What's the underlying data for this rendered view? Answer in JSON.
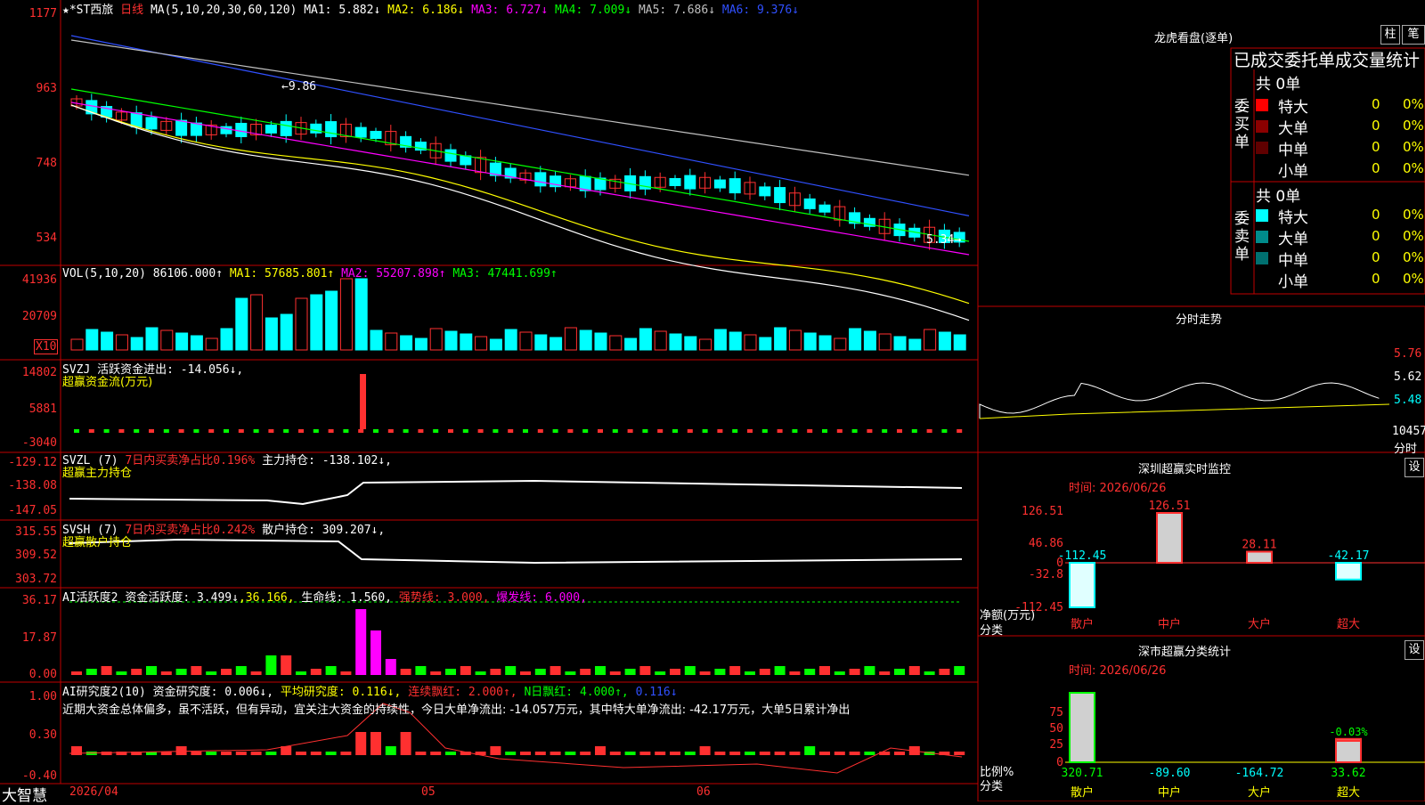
{
  "header": {
    "stock_name": "★*ST西旅",
    "period": "日线",
    "ma_label": "MA(5,10,20,30,60,120)",
    "ma_values": [
      {
        "name": "MA1:",
        "value": "5.882↓",
        "color": "#ffffff"
      },
      {
        "name": "MA2:",
        "value": "6.186↓",
        "color": "#ffff00"
      },
      {
        "name": "MA3:",
        "value": "6.727↓",
        "color": "#ff00ff"
      },
      {
        "name": "MA4:",
        "value": "7.009↓",
        "color": "#00ff00"
      },
      {
        "name": "MA5:",
        "value": "7.686↓",
        "color": "#c0c0c0"
      },
      {
        "name": "MA6:",
        "value": "9.376↓",
        "color": "#3050ff"
      }
    ]
  },
  "price_axis": [
    "1177",
    "963",
    "748",
    "534"
  ],
  "price_annotations": {
    "high": "9.86",
    "low": "5.34"
  },
  "vol": {
    "label": "VOL(5,10,20)",
    "value": "86106.000↑",
    "ma1": "MA1: 57685.801↑",
    "ma2": "MA2: 55207.898↑",
    "ma3": "MA3: 47441.699↑",
    "axis": [
      "41936",
      "20709"
    ],
    "unit": "X10"
  },
  "svzj": {
    "title": "SVZJ  活跃资金进出: -14.056↓,",
    "subtitle": "超赢资金流(万元)",
    "axis": [
      "14802",
      "5881",
      "-3040"
    ]
  },
  "svzl": {
    "title_a": "SVZL (7)",
    "title_b": "7日内买卖净占比0.196%",
    "title_c": "主力持仓: -138.102↓,",
    "subtitle": "超赢主力持仓",
    "axis": [
      "-129.12",
      "-138.08",
      "-147.05"
    ]
  },
  "svsh": {
    "title_a": "SVSH (7)",
    "title_b": "7日内买卖净占比0.242%",
    "title_c": "散户持仓: 309.207↓,",
    "subtitle": "超赢散户持仓",
    "axis": [
      "315.55",
      "309.52",
      "303.72"
    ]
  },
  "ai_active": {
    "t1": "AI活跃度2",
    "t2": "资金活跃度: 3.499↓",
    "t3": ",36.166,",
    "t4": "生命线: 1.560,",
    "t5": "强势线: 3.000,",
    "t6": "爆发线: 6.000,",
    "axis": [
      "36.17",
      "17.87",
      "0.00"
    ]
  },
  "ai_research": {
    "t1": "AI研究度2(10)",
    "t2": "资金研究度: 0.006↓,",
    "t3": "平均研究度: 0.116↓,",
    "t4": "连续飘红: 2.000↑,",
    "t5": "N日飘红: 4.000↑,",
    "t6": "0.116↓",
    "note": "近期大资金总体偏多，虽不活跃，但有异动，宜关注大资金的持续性，今日大单净流出: -14.057万元，其中特大单净流出: -42.17万元，大单5日累计净出",
    "axis": [
      "1.00",
      "0.30",
      "-0.40"
    ]
  },
  "bottom": {
    "brand": "大智慧",
    "dates": [
      "2026/04",
      "05",
      "06"
    ]
  },
  "right": {
    "dragon_title": "龙虎看盘(逐单)",
    "btn_column": "柱",
    "btn_stroke": "笔",
    "stats_title": "已成交委托单成交量统计",
    "buy_label": "委买单",
    "sell_label": "委卖单",
    "total_label": "共 0单",
    "rows": [
      {
        "name": "特大",
        "count": "0",
        "pct": "0%"
      },
      {
        "name": "大单",
        "count": "0",
        "pct": "0%"
      },
      {
        "name": "中单",
        "count": "0",
        "pct": "0%"
      },
      {
        "name": "小单",
        "count": "0",
        "pct": "0%"
      }
    ],
    "intraday_title": "分时走势",
    "intraday_axis": [
      "5.76",
      "5.62",
      "5.48"
    ],
    "intraday_vol": "10457",
    "intraday_vol_label": "分时",
    "monitor_title": "深圳超赢实时监控",
    "monitor_time": "时间: 2026/06/26",
    "net_label": "净额(万元)",
    "class_label": "分类",
    "classify_title": "深市超赢分类统计",
    "classify_time": "时间: 2026/06/26",
    "ratio_label": "比例%",
    "set_btn": "设",
    "categories": [
      "散户",
      "中户",
      "大户",
      "超大"
    ]
  },
  "colors": {
    "up": "#ff3030",
    "down": "#00ffff",
    "grid": "#c00000",
    "ma1": "#ffffff",
    "ma2": "#ffff00",
    "ma3": "#ff00ff",
    "ma4": "#00ff00",
    "ma5": "#c0c0c0",
    "ma6": "#3050ff"
  },
  "chart_data": [
    {
      "type": "bar",
      "title": "深圳超赢实时监控",
      "categories": [
        "散户",
        "中户",
        "大户",
        "超大"
      ],
      "values": [
        -112.45,
        126.51,
        28.11,
        -42.17
      ],
      "ylabel": "净额(万元)",
      "yticks": [
        "126.51",
        "46.86",
        "0",
        "-32.8",
        "-112.45"
      ],
      "ylim": [
        -112.45,
        126.51
      ]
    },
    {
      "type": "bar",
      "title": "深市超赢分类统计",
      "categories": [
        "散户",
        "中户",
        "大户",
        "超大"
      ],
      "values": [
        320.71,
        -89.6,
        -164.72,
        33.62
      ],
      "bar_labels": [
        "",
        "",
        "",
        "-0.03%"
      ],
      "value_labels": [
        "320.71",
        "-89.60",
        "-164.72",
        "33.62"
      ],
      "ylabel": "比例%",
      "yticks": [
        "75",
        "50",
        "25",
        "0"
      ],
      "ylim": [
        0,
        100
      ]
    }
  ]
}
